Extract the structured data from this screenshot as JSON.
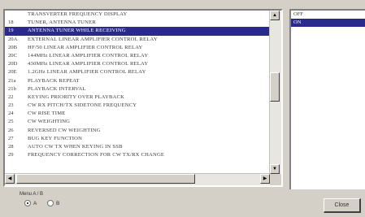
{
  "menu": {
    "items": [
      {
        "num": "",
        "text": "TRANSVERTER FREQUENCY DISPLAY",
        "selected": false
      },
      {
        "num": "18",
        "text": "TUNER, ANTENNA TUNER",
        "selected": false
      },
      {
        "num": "19",
        "text": "ANTENNA TUNER WHILE RECEIVING",
        "selected": true
      },
      {
        "num": "20A",
        "text": "EXTERNAL LINEAR AMPLIFIER CONTROL RELAY",
        "selected": false
      },
      {
        "num": "20B",
        "text": "HF/50 LINEAR AMPLIFIER CONTROL RELAY",
        "selected": false
      },
      {
        "num": "20C",
        "text": "144MHz LINEAR AMPLIFIER CONTROL RELAY",
        "selected": false
      },
      {
        "num": "20D",
        "text": "430MHz LINEAR AMPLIFIER CONTROL RELAY",
        "selected": false
      },
      {
        "num": "20E",
        "text": "1.2GHz LINEAR AMPLIFIER CONTROL RELAY",
        "selected": false
      },
      {
        "num": "21a",
        "text": "PLAYBACK REPEAT",
        "selected": false
      },
      {
        "num": "21b",
        "text": "PLAYBACK INTERVAL",
        "selected": false
      },
      {
        "num": "22",
        "text": "KEYING PRIORITY OVER PLAYBACK",
        "selected": false
      },
      {
        "num": "23",
        "text": "CW RX PITCH/TX SIDETONE FREQUENCY",
        "selected": false
      },
      {
        "num": "24",
        "text": "CW RISE TIME",
        "selected": false
      },
      {
        "num": "25",
        "text": "CW WEIGHTING",
        "selected": false
      },
      {
        "num": "26",
        "text": "REVERSED CW WEIGHTING",
        "selected": false
      },
      {
        "num": "27",
        "text": "BUG KEY FUNCTION",
        "selected": false
      },
      {
        "num": "28",
        "text": "AUTO CW TX WHEN KEYING IN SSB",
        "selected": false
      },
      {
        "num": "29",
        "text": "FREQUENCY CORRECTION FOR CW TX/RX CHANGE",
        "selected": false
      }
    ],
    "vscroll": {
      "up_glyph": "▲",
      "down_glyph": "▼"
    },
    "hscroll": {
      "left_glyph": "◀",
      "right_glyph": "▶"
    }
  },
  "values": {
    "items": [
      {
        "text": "OFF",
        "selected": false
      },
      {
        "text": "ON",
        "selected": true
      }
    ]
  },
  "controls": {
    "group_label": "Menu A / B",
    "radio_a": "A",
    "radio_b": "B",
    "radio_selected": "A",
    "close_label": "Close"
  },
  "colors": {
    "selection": "#2a2a8c",
    "face": "#d4d0c8"
  }
}
